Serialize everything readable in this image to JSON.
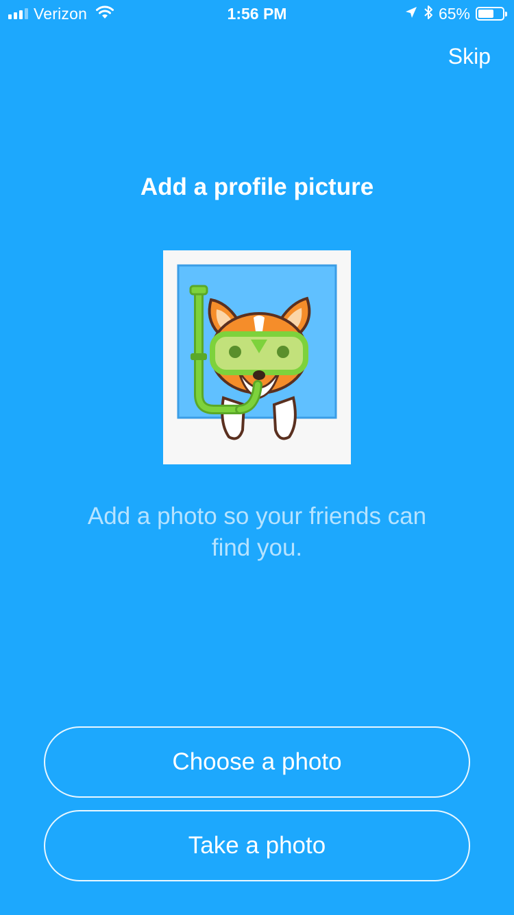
{
  "status_bar": {
    "carrier": "Verizon",
    "time": "1:56 PM",
    "battery_percent": "65%",
    "battery_level": 0.65,
    "signal_bars": 3,
    "icons": [
      "signal-icon",
      "wifi-icon",
      "location-arrow-icon",
      "bluetooth-icon",
      "battery-icon"
    ]
  },
  "header": {
    "skip_label": "Skip"
  },
  "main": {
    "title": "Add a profile picture",
    "illustration": "corgi-snorkel-illustration",
    "subtitle": "Add a photo so your friends can find you."
  },
  "actions": {
    "choose_label": "Choose a photo",
    "take_label": "Take a photo"
  },
  "colors": {
    "background": "#1da8fd",
    "frame": "#f7f7f7",
    "photo_bg": "#60c0ff",
    "snorkel": "#7dd23c",
    "dog": "#f58d2a"
  }
}
